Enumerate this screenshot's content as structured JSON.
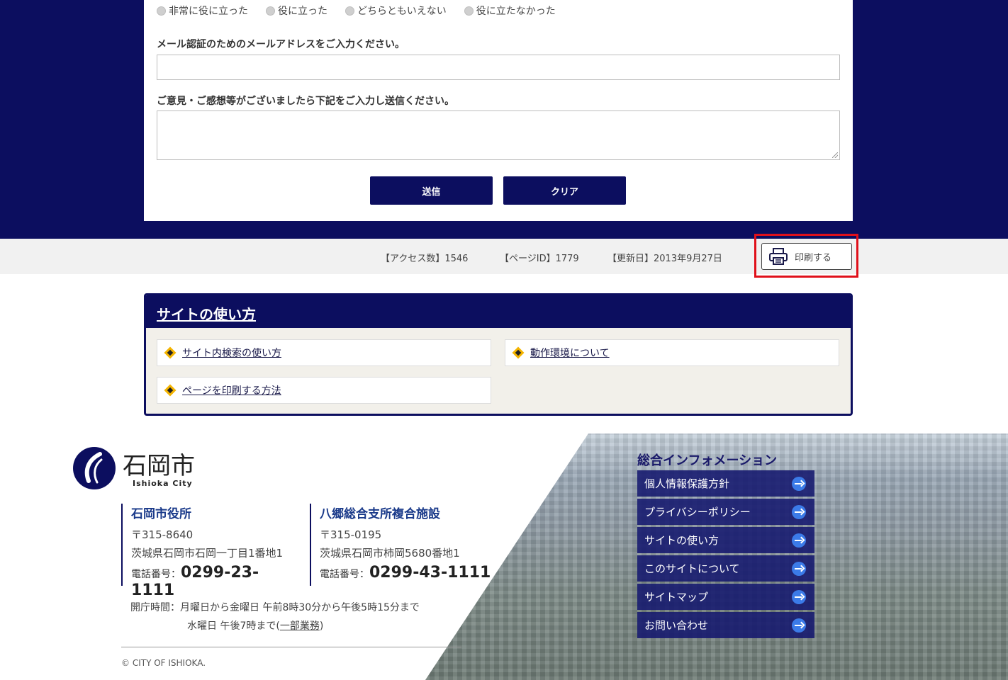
{
  "survey": {
    "options": [
      "非常に役に立った",
      "役に立った",
      "どちらともいえない",
      "役に立たなかった"
    ],
    "email_label": "メール認証のためのメールアドレスをご入力ください。",
    "comment_label": "ご意見・ご感想等がございましたら下記をご入力し送信ください。",
    "email_value": "",
    "comment_value": "",
    "submit_label": "送信",
    "clear_label": "クリア"
  },
  "page_meta": {
    "access": "【アクセス数】1546",
    "page_id": "【ページID】1779",
    "updated": "【更新日】2013年9月27日",
    "print_label": "印刷する"
  },
  "site_usage": {
    "title": "サイトの使い方",
    "links": [
      "サイト内検索の使い方",
      "動作環境について",
      "ページを印刷する方法"
    ]
  },
  "footer": {
    "logo_name": "石岡市",
    "logo_sub": "Ishioka City",
    "offices": [
      {
        "name": "石岡市役所",
        "zip": "〒315-8640",
        "address": "茨城県石岡市石岡一丁目1番地1",
        "tel_label": "電話番号：",
        "tel": "0299-23-1111"
      },
      {
        "name": "八郷総合支所複合施設",
        "zip": "〒315-0195",
        "address": "茨城県石岡市柿岡5680番地1",
        "tel_label": "電話番号：",
        "tel": "0299-43-1111"
      }
    ],
    "hours_line1": "開庁時間：月曜日から金曜日 午前8時30分から午後5時15分まで",
    "hours_line2_pre": "水曜日 午後7時まで(",
    "hours_line2_link": "一部業務",
    "hours_line2_post": ")",
    "copyright": "© CITY OF ISHIOKA.",
    "info_title": "総合インフォメーション",
    "info_menu": [
      "個人情報保護方針",
      "プライバシーポリシー",
      "サイトの使い方",
      "このサイトについて",
      "サイトマップ",
      "お問い合わせ"
    ]
  },
  "colors": {
    "navy": "#0c0e5f",
    "highlight": "#e0101a",
    "accent": "#f4b400"
  }
}
